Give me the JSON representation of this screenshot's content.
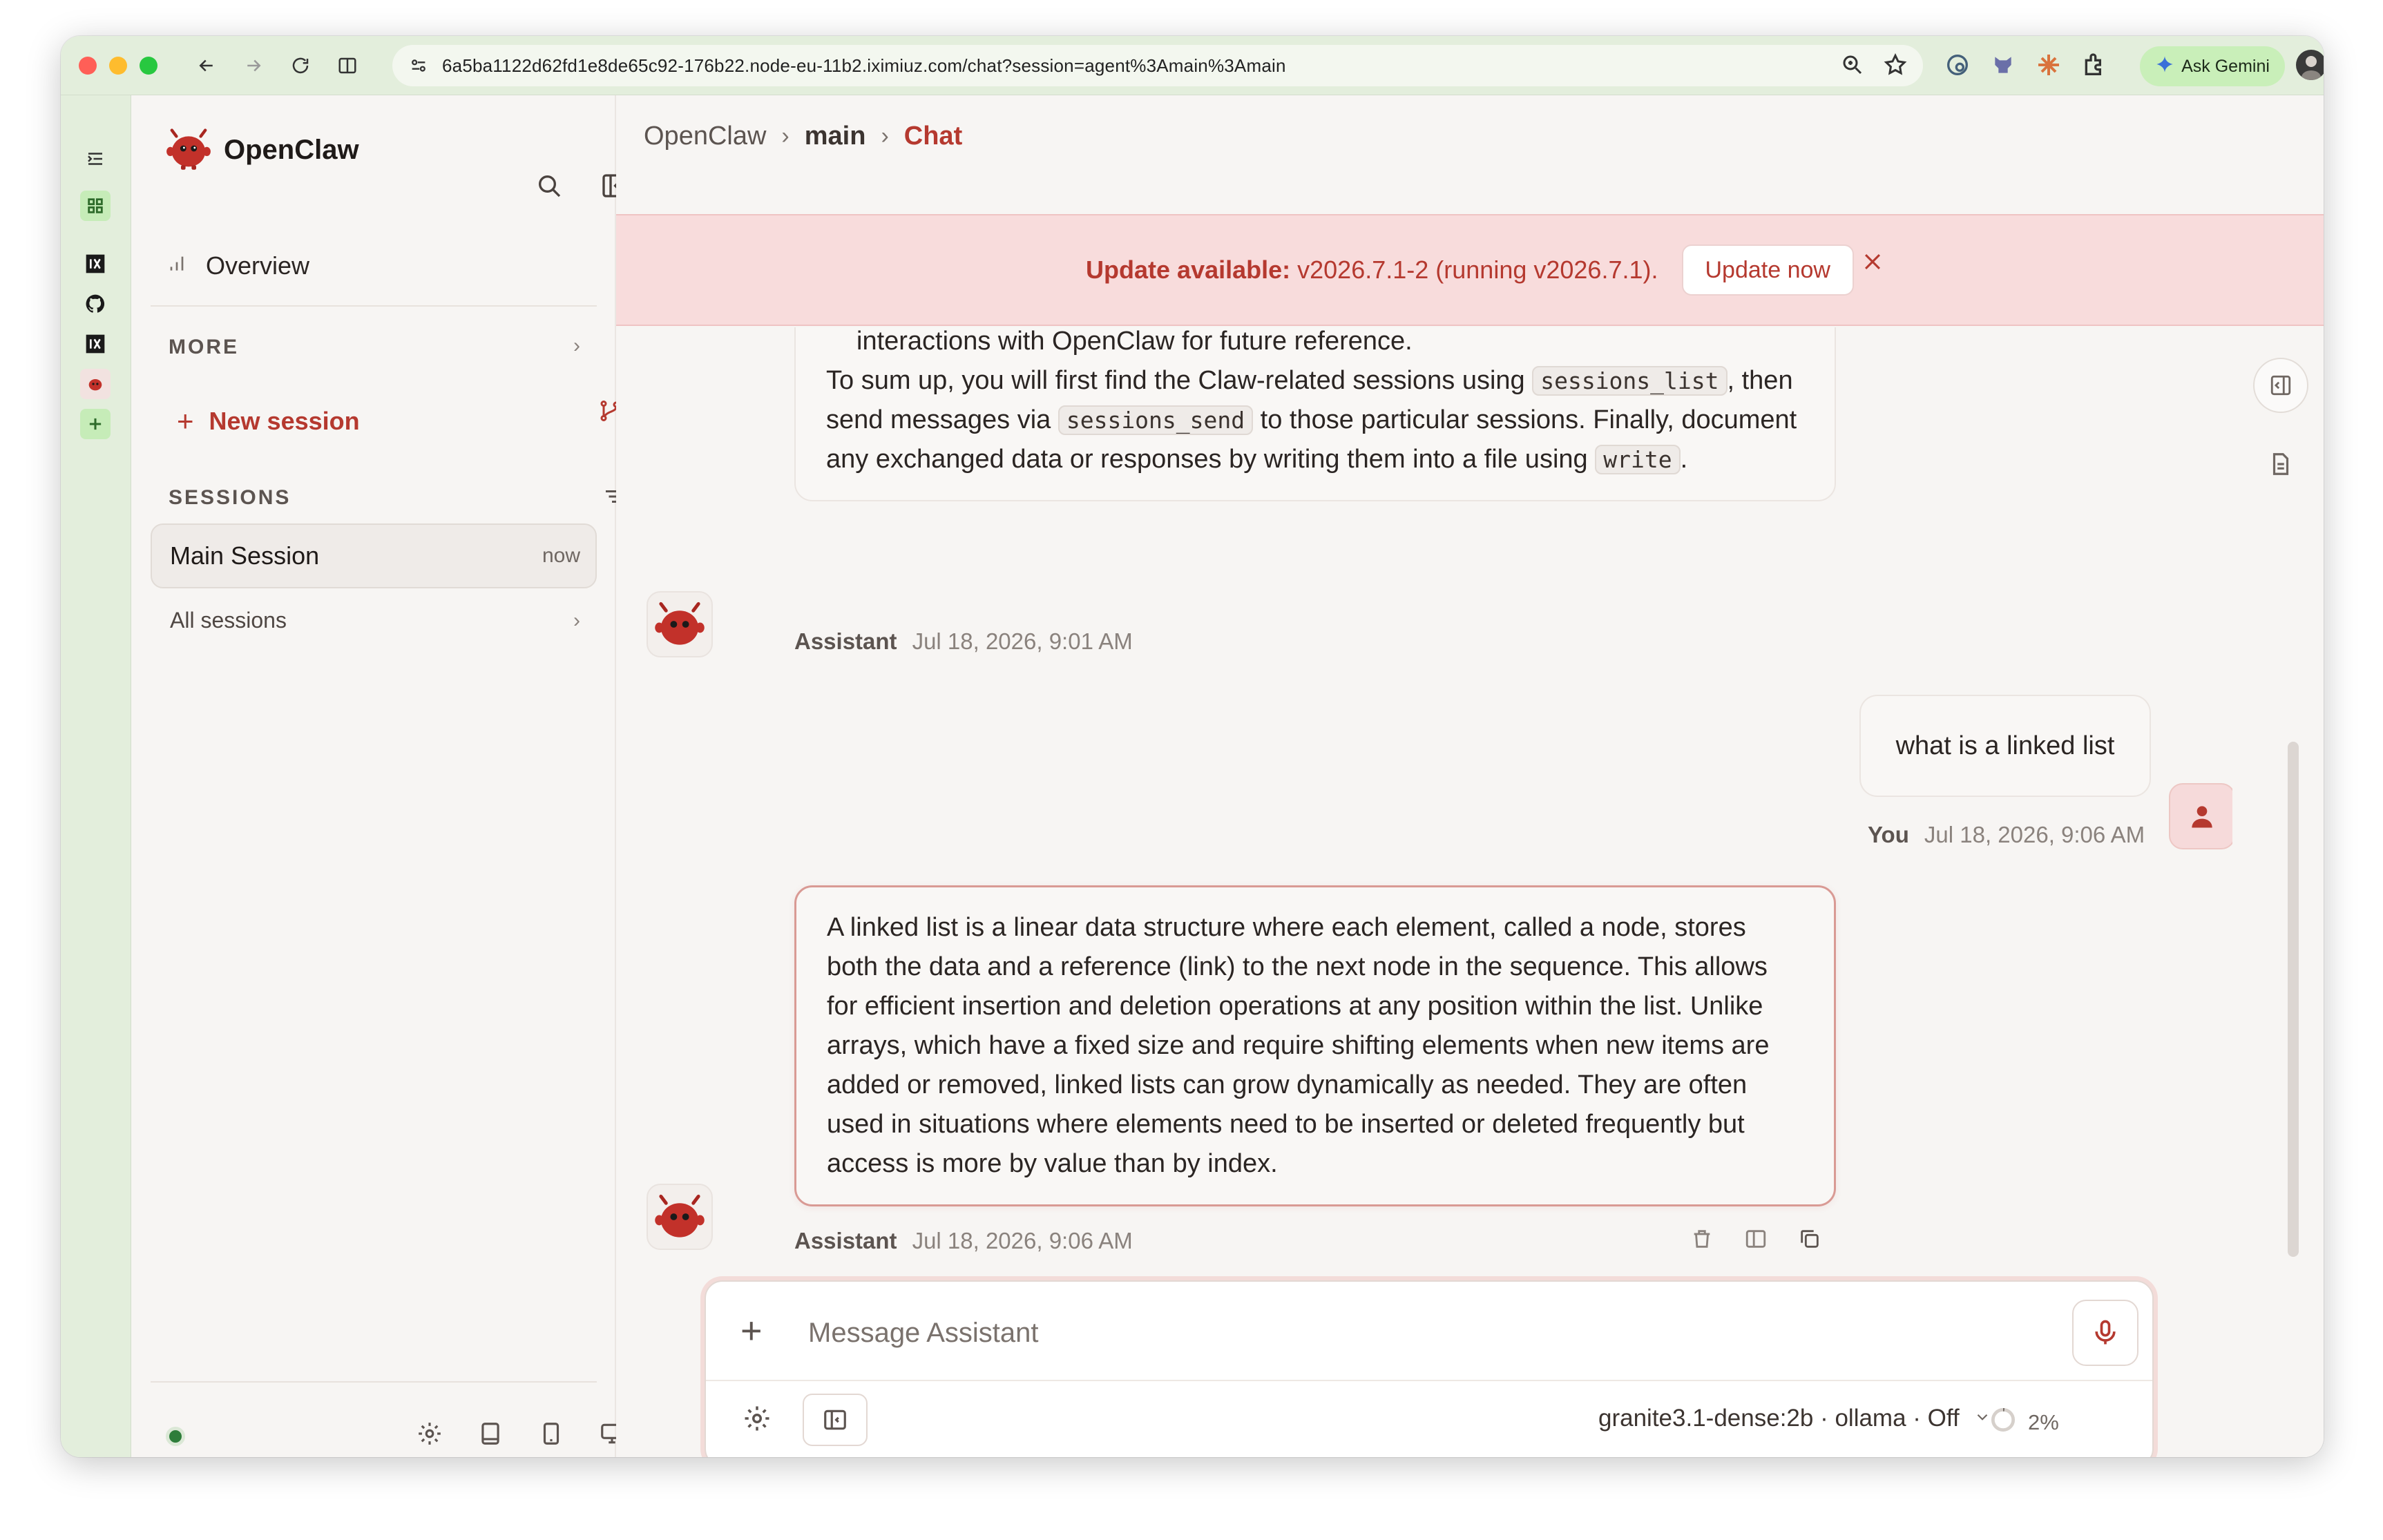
{
  "browser": {
    "url": "6a5ba1122d62fd1e8de65c92-176b22.node-eu-11b2.iximiuz.com/chat?session=agent%3Amain%3Amain",
    "gemini_label": "Ask Gemini"
  },
  "sidebar": {
    "brand": "OpenClaw",
    "overview_label": "Overview",
    "more_label": "MORE",
    "new_session_label": "New session",
    "sessions_label": "SESSIONS",
    "sessions": [
      {
        "title": "Main Session",
        "time": "now"
      }
    ],
    "all_sessions_label": "All sessions"
  },
  "breadcrumb": {
    "root": "OpenClaw",
    "sep": "›",
    "middle": "main",
    "current": "Chat"
  },
  "banner": {
    "prefix": "Update available:",
    "text": " v2026.7.1-2 (running v2026.7.1).",
    "button": "Update now"
  },
  "messages": {
    "prev": {
      "line1": "interactions with OpenClaw for future reference.",
      "p_a": "To sum up, you will first find the Claw-related sessions using ",
      "code_a": "sessions_list",
      "p_b": ", then send messages via ",
      "code_b": "sessions_send",
      "p_c": " to those particular sessions. Finally, document any exchanged data or responses by writing them into a file using ",
      "code_c": "write",
      "p_d": ".",
      "author": "Assistant",
      "time": "Jul 18, 2026, 9:01 AM"
    },
    "user": {
      "text": "what is a linked list",
      "author": "You",
      "time": "Jul 18, 2026, 9:06 AM"
    },
    "answer": {
      "text": "A linked list is a linear data structure where each element, called a node, stores both the data and a reference (link) to the next node in the sequence. This allows for efficient insertion and deletion operations at any position within the list. Unlike arrays, which have a fixed size and require shifting elements when new items are added or removed, linked lists can grow dynamically as needed. They are often used in situations where elements need to be inserted or deleted frequently but access is more by value than by index.",
      "author": "Assistant",
      "time": "Jul 18, 2026, 9:06 AM"
    }
  },
  "composer": {
    "add_symbol": "+",
    "placeholder": "Message Assistant",
    "model": "granite3.1-dense:2b · ollama · Off",
    "context": "2%"
  },
  "colors": {
    "accent": "#b5392f",
    "banner_bg": "#f8dcdc",
    "rail_bg": "#e3eedc"
  },
  "icons": [
    "search-icon",
    "sidebar-toggle-icon",
    "branch-icon",
    "filter-icon",
    "gear-icon",
    "book-icon",
    "tablet-icon",
    "monitor-icon",
    "close-icon",
    "trash-icon",
    "panel-icon",
    "copy-icon",
    "mic-icon",
    "document-icon",
    "user-icon"
  ]
}
